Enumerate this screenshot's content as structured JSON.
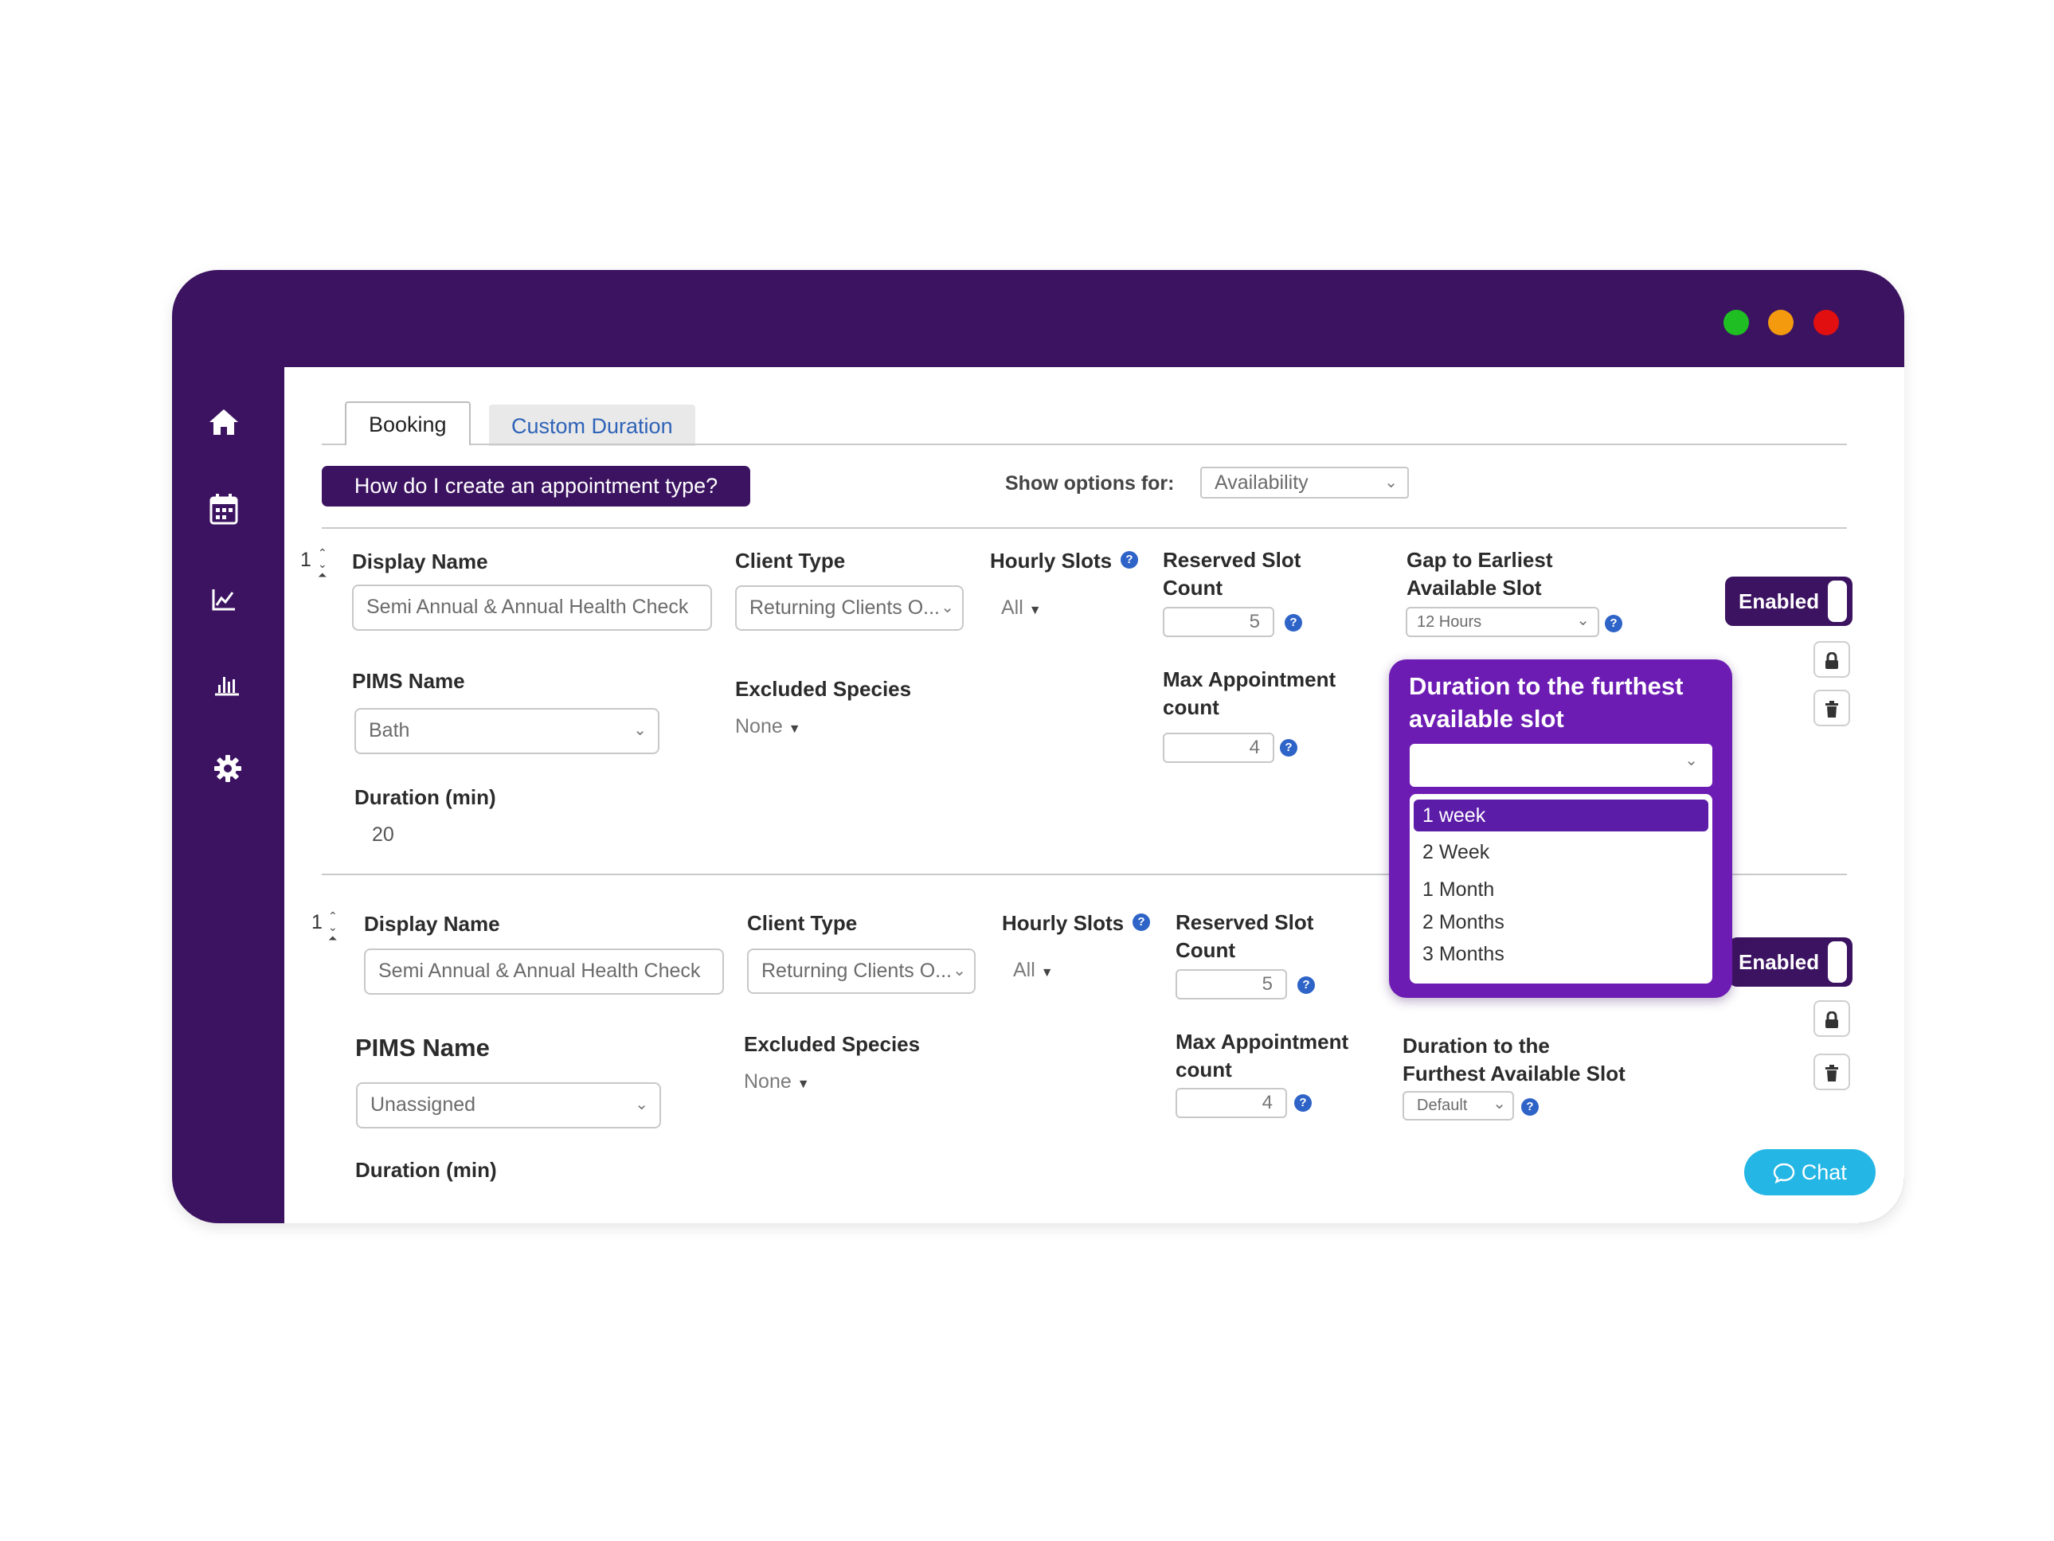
{
  "colors": {
    "brand_purple": "#3c1361",
    "popup_purple": "#6c1cb3",
    "selected_purple": "#5b1ca8",
    "chat_blue": "#24b6e5",
    "help_blue": "#2e63c7",
    "dot_green": "#1fbf24",
    "dot_orange": "#f39a0e",
    "dot_red": "#e10f0f"
  },
  "sidebar": {
    "icons": [
      "home-icon",
      "calendar-icon",
      "line-chart-icon",
      "bar-chart-icon",
      "gear-icon"
    ]
  },
  "tabs": [
    {
      "label": "Booking",
      "active": true
    },
    {
      "label": "Custom Duration",
      "active": false
    }
  ],
  "help_button": "How do I create an appointment type?",
  "show_options": {
    "label": "Show options for:",
    "value": "Availability"
  },
  "row1": {
    "index": "1",
    "display_name": {
      "label": "Display Name",
      "value": "Semi Annual & Annual Health Check"
    },
    "client_type": {
      "label": "Client Type",
      "value": "Returning Clients O..."
    },
    "hourly_slots": {
      "label": "Hourly Slots",
      "value": "All"
    },
    "reserved_slot": {
      "label_line1": "Reserved Slot",
      "label_line2": "Count",
      "value": "5"
    },
    "gap": {
      "label_line1": "Gap to Earliest",
      "label_line2": "Available Slot",
      "value": "12 Hours"
    },
    "enabled_label": "Enabled",
    "pims": {
      "label": "PIMS Name",
      "value": "Bath"
    },
    "excluded_species": {
      "label": "Excluded Species",
      "value": "None"
    },
    "max_appt": {
      "label_line1": "Max Appointment",
      "label_line2": "count",
      "value": "4"
    },
    "duration": {
      "label": "Duration (min)",
      "value": "20"
    }
  },
  "popup": {
    "title_line1": "Duration to the furthest",
    "title_line2": "available slot",
    "options": [
      "1 week",
      "2 Week",
      "1 Month",
      "2 Months",
      "3 Months"
    ],
    "selected_index": 0
  },
  "row2": {
    "index": "1",
    "display_name": {
      "label": "Display Name",
      "value": "Semi Annual & Annual Health Check"
    },
    "client_type": {
      "label": "Client Type",
      "value": "Returning Clients O..."
    },
    "hourly_slots": {
      "label": "Hourly Slots",
      "value": "All"
    },
    "reserved_slot": {
      "label_line1": "Reserved Slot",
      "label_line2": "Count",
      "value": "5"
    },
    "enabled_label": "Enabled",
    "pims": {
      "label": "PIMS Name",
      "value": "Unassigned"
    },
    "excluded_species": {
      "label": "Excluded Species",
      "value": "None"
    },
    "max_appt": {
      "label_line1": "Max Appointment",
      "label_line2": "count",
      "value": "4"
    },
    "furthest": {
      "label_line1": "Duration to the",
      "label_line2": "Furthest Available Slot",
      "value": "Default"
    },
    "duration": {
      "label": "Duration (min)"
    }
  },
  "chat_label": "Chat"
}
